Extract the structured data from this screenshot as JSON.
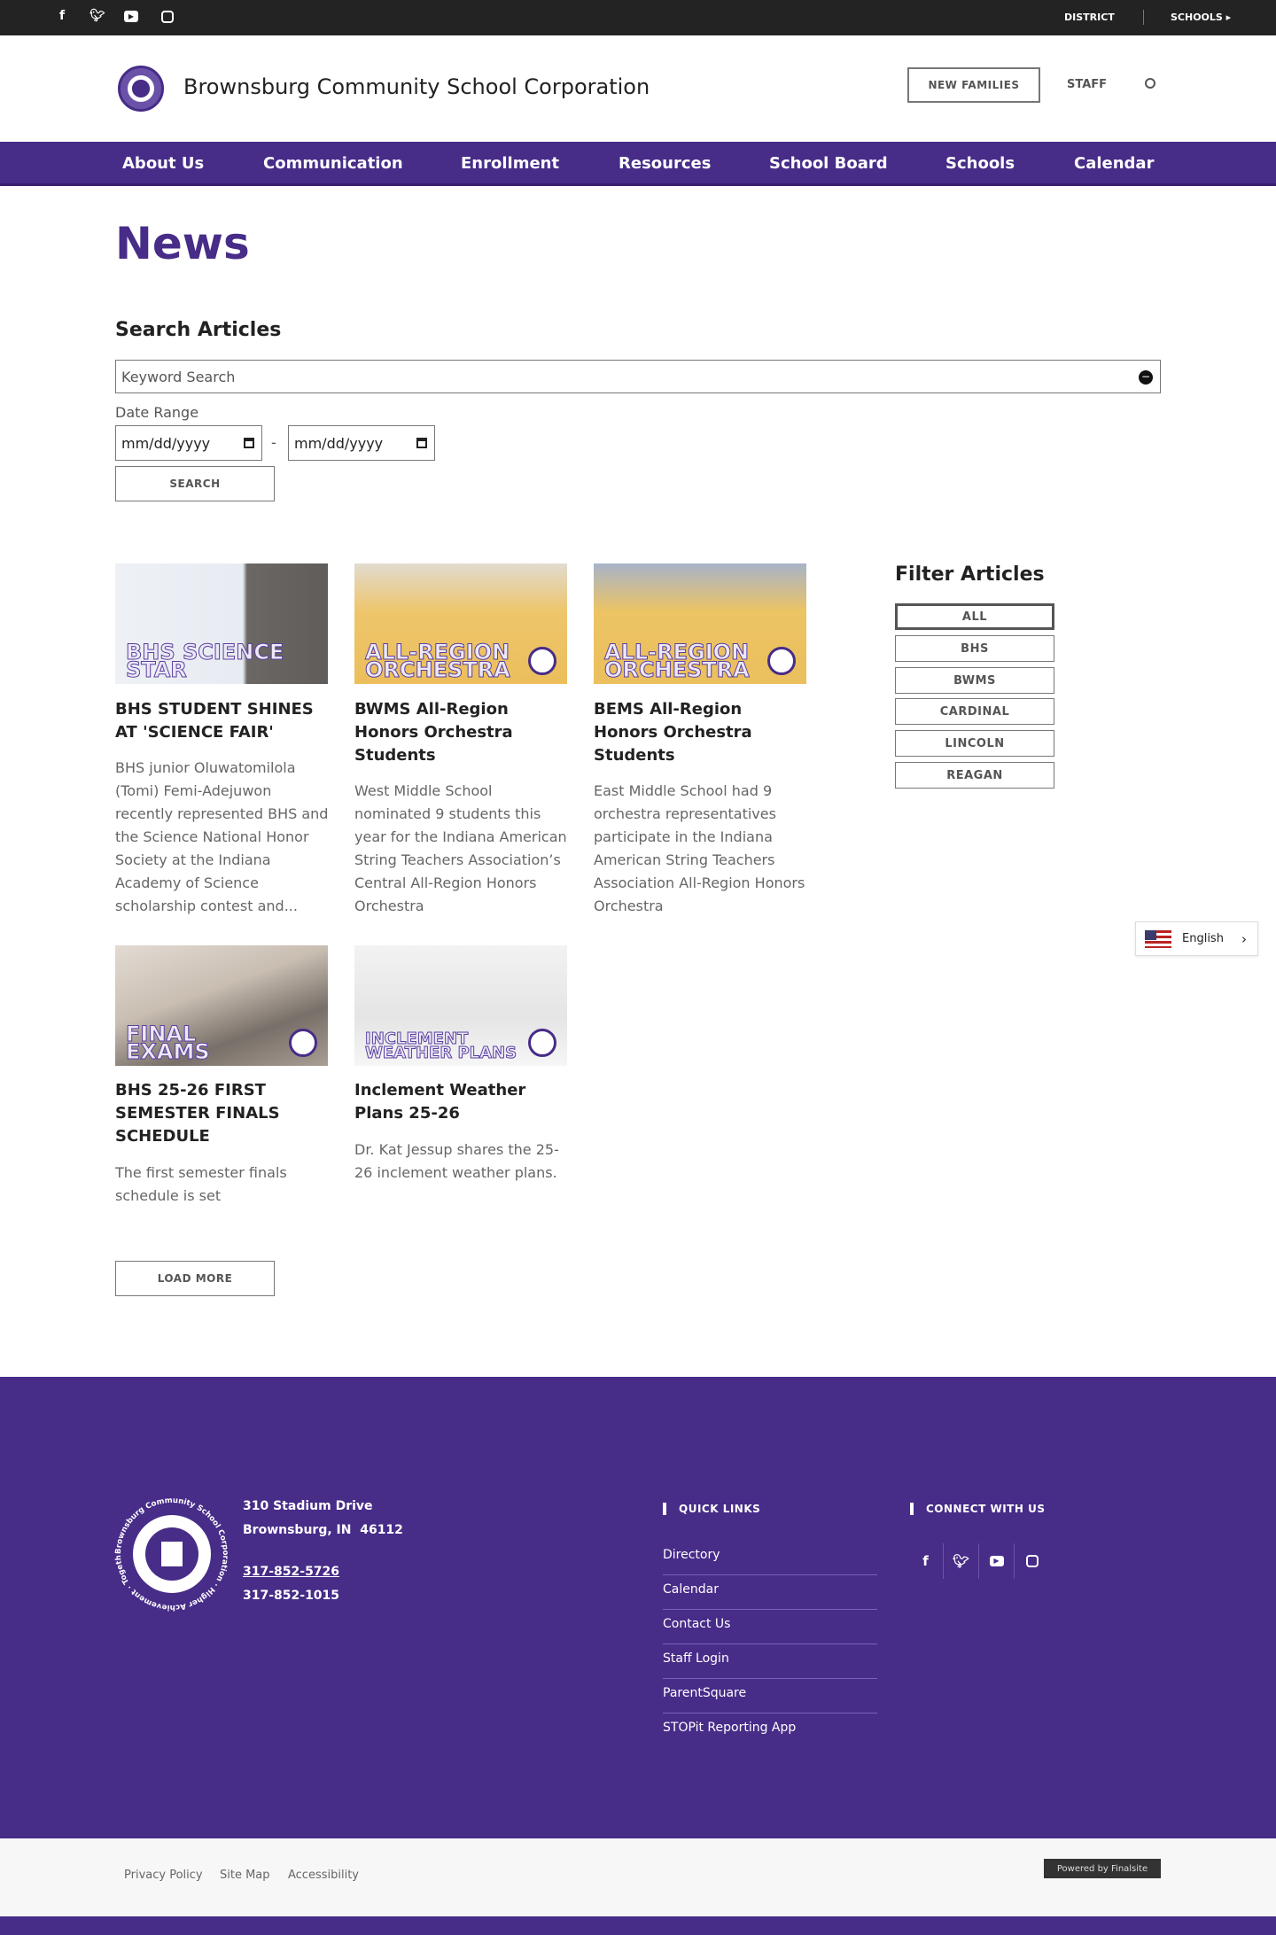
{
  "topbar": {
    "social": [
      "facebook-icon",
      "twitter-icon",
      "youtube-icon",
      "instagram-icon"
    ],
    "district": "DISTRICT",
    "schools": "SCHOOLS"
  },
  "header": {
    "title": "Brownsburg Community School Corporation",
    "new_families": "NEW FAMILIES",
    "staff": "STAFF"
  },
  "nav": [
    "About Us",
    "Communication",
    "Enrollment",
    "Resources",
    "School Board",
    "Schools",
    "Calendar"
  ],
  "page_title": "News",
  "search": {
    "heading": "Search Articles",
    "keyword_placeholder": "Keyword Search",
    "date_label": "Date Range",
    "date_placeholder": "mm/dd/yyyy",
    "dash": "-",
    "button": "SEARCH"
  },
  "articles": [
    {
      "overlay": "BHS SCIENCE STAR",
      "title": "BHS STUDENT SHINES AT 'SCIENCE FAIR'",
      "desc": "BHS junior Oluwatomilola (Tomi) Femi-Adejuwon recently represented BHS and the Science National Honor Society at the Indiana Academy of Science scholarship contest and..."
    },
    {
      "overlay": "ALL-REGION ORCHESTRA",
      "title": "BWMS All-Region Honors Orchestra Students",
      "desc": "West Middle School nominated 9 students this year for the Indiana American String Teachers Association’s Central All-Region Honors Orchestra"
    },
    {
      "overlay": "ALL-REGION ORCHESTRA",
      "title": "BEMS All-Region Honors Orchestra Students",
      "desc": "East Middle School had 9 orchestra representatives participate in the Indiana American String Teachers Association All-Region Honors Orchestra"
    },
    {
      "overlay": "FINAL EXAMS",
      "title": "BHS 25-26 FIRST SEMESTER FINALS SCHEDULE",
      "desc": "The first semester finals schedule is set"
    },
    {
      "overlay": "INCLEMENT WEATHER PLANS",
      "title": "Inclement Weather Plans 25-26",
      "desc": "Dr. Kat Jessup shares the 25-26 inclement weather plans."
    }
  ],
  "load_more": "LOAD MORE",
  "filter": {
    "heading": "Filter Articles",
    "options": [
      "ALL",
      "BHS",
      "BWMS",
      "CARDINAL",
      "LINCOLN",
      "REAGAN"
    ],
    "selected": "ALL"
  },
  "language": {
    "label": "English"
  },
  "footer": {
    "address1": "310 Stadium Drive",
    "address2": "Brownsburg, IN  46112",
    "phone1": "317-852-5726",
    "phone2": "317-852-1015",
    "logo_text": "Brownsburg Community School Corporation · Higher Achievement · Together",
    "quick_links_heading": "QUICK LINKS",
    "quick_links": [
      "Directory",
      "Calendar",
      "Contact Us",
      "Staff Login",
      "ParentSquare",
      "STOPit Reporting App"
    ],
    "connect_heading": "CONNECT WITH US"
  },
  "bottom": {
    "links": [
      "Privacy Policy",
      "Site Map",
      "Accessibility"
    ],
    "powered": "Powered by Finalsite"
  },
  "colors": {
    "brand": "#472c88",
    "topbar": "#232323"
  }
}
